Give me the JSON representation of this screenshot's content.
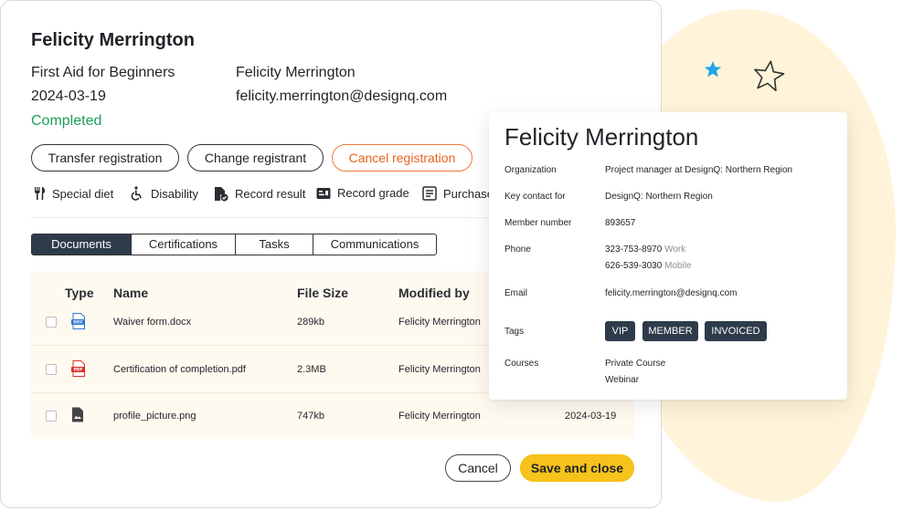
{
  "colors": {
    "accent": "#f7c21c",
    "status_completed": "#1aa05a",
    "cancel_orange": "#e8641b",
    "tab_active": "#2e3b4b"
  },
  "registration": {
    "title": "Felicity Merrington",
    "course": "First Aid for Beginners",
    "date": "2024-03-19",
    "status": "Completed",
    "attendee_name": "Felicity Merrington",
    "attendee_email": "felicity.merrington@designq.com"
  },
  "buttons": {
    "transfer": "Transfer registration",
    "change": "Change registrant",
    "cancel_registration": "Cancel registration",
    "cancel": "Cancel",
    "save_close": "Save and close"
  },
  "actions": [
    {
      "label": "Special diet",
      "icon": "utensils-icon"
    },
    {
      "label": "Disability",
      "icon": "wheelchair-icon"
    },
    {
      "label": "Record result",
      "icon": "document-check-icon"
    },
    {
      "label": "Record grade",
      "icon": "grade-card-icon"
    },
    {
      "label": "Purchase",
      "icon": "receipt-icon"
    }
  ],
  "tabs": [
    "Documents",
    "Certifications",
    "Tasks",
    "Communications"
  ],
  "table": {
    "headers": {
      "type": "Type",
      "name": "Name",
      "size": "File Size",
      "modified": "Modified by"
    },
    "rows": [
      {
        "icon": "doc-file-icon",
        "icon_text": "DOC",
        "name": "Waiver form.docx",
        "size": "289kb",
        "modified_by": "Felicity Merrington",
        "date": ""
      },
      {
        "icon": "pdf-file-icon",
        "icon_text": "PDF",
        "name": "Certification of completion.pdf",
        "size": "2.3MB",
        "modified_by": "Felicity Merrington",
        "date": ""
      },
      {
        "icon": "image-file-icon",
        "icon_text": "",
        "name": "profile_picture.png",
        "size": "747kb",
        "modified_by": "Felicity Merrington",
        "date": "2024-03-19"
      }
    ]
  },
  "contact": {
    "name": "Felicity Merrington",
    "organization_label": "Organization",
    "organization_prefix": "Project manager at ",
    "organization_value": "DesignQ: Northern Region",
    "key_contact_label": "Key contact for",
    "key_contact_value": "DesignQ: Northern Region",
    "member_number_label": "Member number",
    "member_number_value": "893657",
    "phone_label": "Phone",
    "phones": [
      {
        "number": "323-753-8970",
        "type": "Work"
      },
      {
        "number": "626-539-3030",
        "type": "Mobile"
      }
    ],
    "email_label": "Email",
    "email_value": "felicity.merrington@designq.com",
    "tags_label": "Tags",
    "tags": [
      "VIP",
      "MEMBER",
      "INVOICED"
    ],
    "courses_label": "Courses",
    "courses": [
      "Private Course",
      "Webinar"
    ]
  }
}
